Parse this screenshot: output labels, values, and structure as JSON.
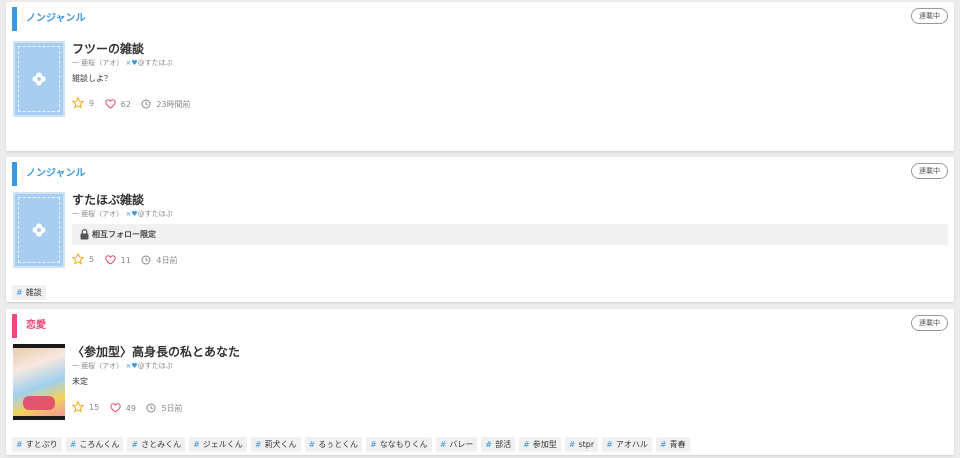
{
  "posts": [
    {
      "genre": "ノンジャンル",
      "status": "連載中",
      "title": "フツーの雑談",
      "author_prefix": "一 亜桜（アオ）",
      "author_suffix": "@すたほぷ",
      "description": "雑談しよ？",
      "stars": "9",
      "likes": "62",
      "updated": "23時間前",
      "tags": []
    },
    {
      "genre": "ノンジャンル",
      "status": "連載中",
      "title": "すたほぷ雑談",
      "author_prefix": "一 亜桜（アオ）",
      "author_suffix": "@すたほぷ",
      "locked_text": "相互フォロー限定",
      "stars": "5",
      "likes": "11",
      "updated": "4日前",
      "tags": [
        "雑談"
      ]
    },
    {
      "genre": "恋愛",
      "status": "連載中",
      "title": "〈参加型〉高身長の私とあなた",
      "author_prefix": "一 亜桜（アオ）",
      "author_suffix": "@すたほぷ",
      "description": "未定",
      "stars": "15",
      "likes": "49",
      "updated": "5日前",
      "tags": [
        "すとぷり",
        "ころんくん",
        "さとみくん",
        "ジェルくん",
        "莉犬くん",
        "るぅとくん",
        "ななもりくん",
        "バレー",
        "部活",
        "参加型",
        "stpr",
        "アオハル",
        "青春"
      ]
    }
  ],
  "colors": {
    "accent_blue": "#3b98e0",
    "accent_pink": "#f0487a"
  },
  "icons": {
    "star": "star-icon",
    "heart": "heart-icon",
    "clock": "clock-icon",
    "lock": "lock-icon"
  }
}
